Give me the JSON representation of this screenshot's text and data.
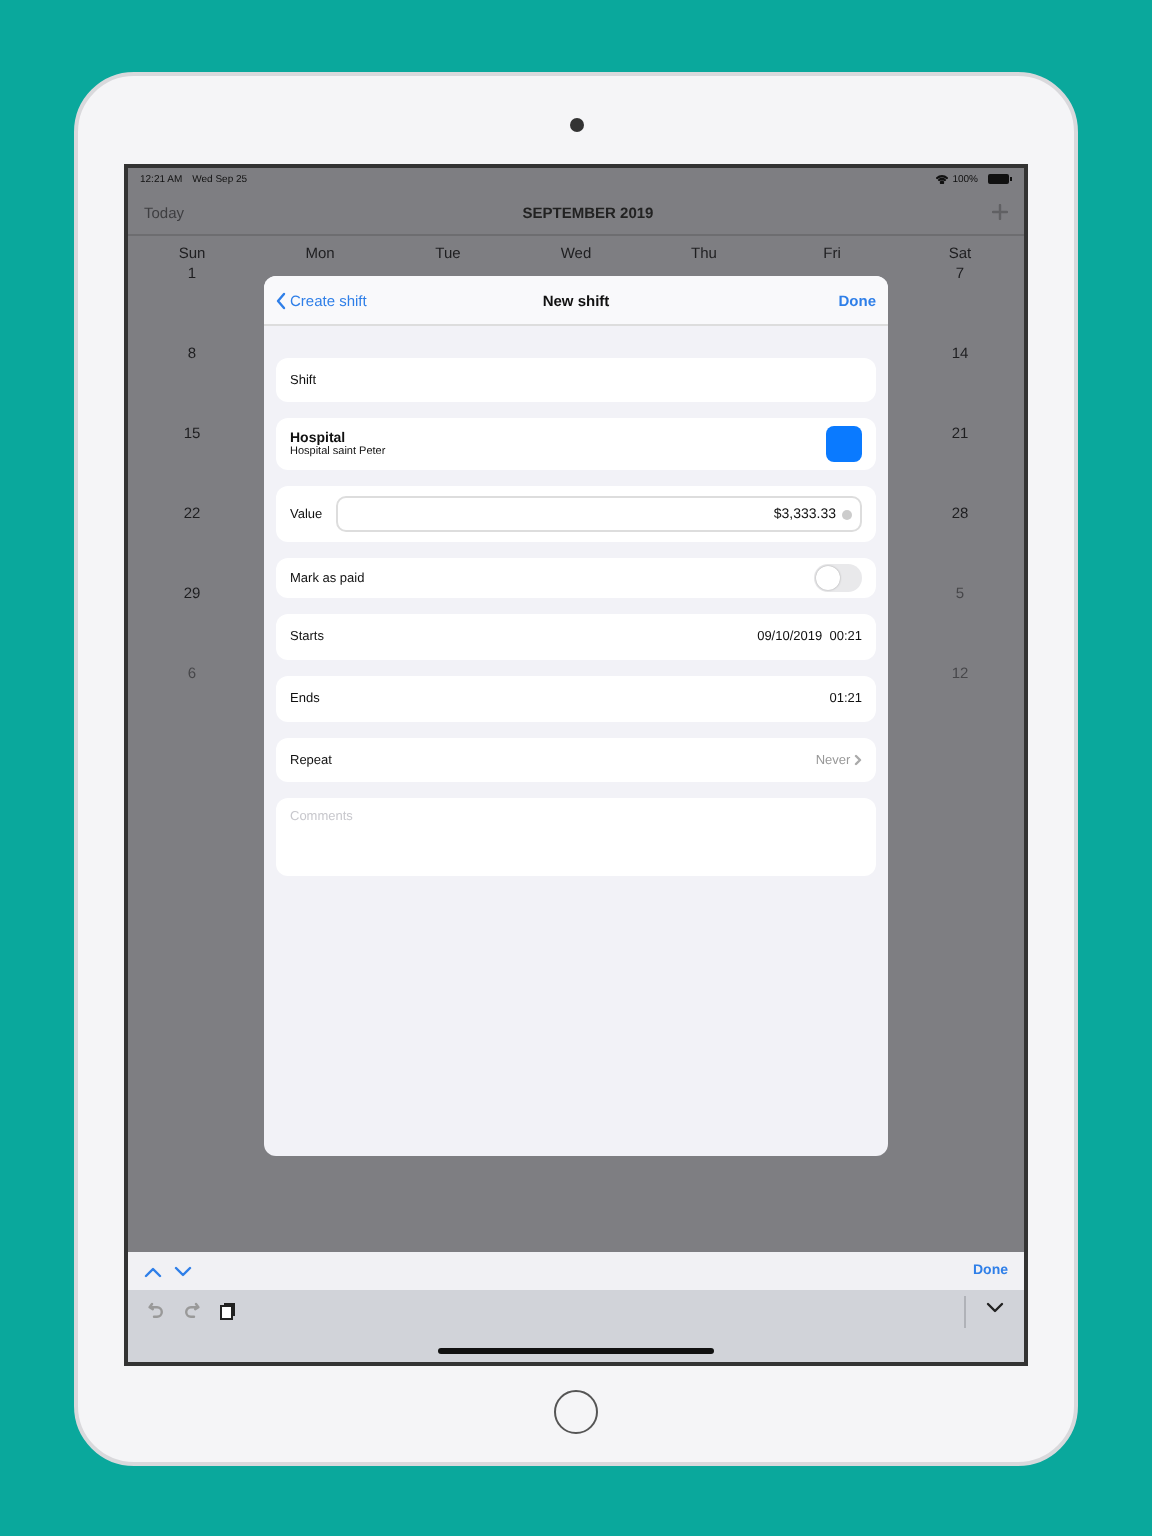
{
  "status_bar": {
    "time": "12:21 AM",
    "date": "Wed Sep 25",
    "battery": "100%"
  },
  "nav_bar": {
    "today": "Today",
    "title": "SEPTEMBER 2019"
  },
  "calendar": {
    "weekdays": [
      "Sun",
      "Mon",
      "Tue",
      "Wed",
      "Thu",
      "Fri",
      "Sat"
    ],
    "weeks": [
      {
        "sun": {
          "day": "1",
          "other_month": false
        },
        "sat": {
          "day": "7",
          "other_month": false
        }
      },
      {
        "sun": {
          "day": "8",
          "other_month": false
        },
        "sat": {
          "day": "14",
          "other_month": false
        }
      },
      {
        "sun": {
          "day": "15",
          "other_month": false
        },
        "sat": {
          "day": "21",
          "other_month": false
        }
      },
      {
        "sun": {
          "day": "22",
          "other_month": false
        },
        "sat": {
          "day": "28",
          "other_month": false
        }
      },
      {
        "sun": {
          "day": "29",
          "other_month": false
        },
        "sat": {
          "day": "5",
          "other_month": true
        }
      },
      {
        "sun": {
          "day": "6",
          "other_month": true
        },
        "sat": {
          "day": "12",
          "other_month": true
        }
      }
    ]
  },
  "sheet": {
    "back": "Create shift",
    "title": "New shift",
    "done": "Done",
    "rows": [
      {
        "kind": "label",
        "label": "Shift"
      },
      {
        "kind": "shift",
        "title": "Hospital",
        "subtitle": "Hospital saint Peter",
        "color": "#0a7aff"
      },
      {
        "kind": "value",
        "label": "Value",
        "value": "$3,333.33"
      },
      {
        "kind": "toggle",
        "label": "Mark as paid",
        "on": false
      },
      {
        "kind": "detail",
        "label": "Starts",
        "value": "09/10/2019  00:21"
      },
      {
        "kind": "detail",
        "label": "Ends",
        "value": "01:21"
      },
      {
        "kind": "disclosure",
        "label": "Repeat",
        "value": "Never"
      },
      {
        "kind": "comments",
        "placeholder": "Comments"
      }
    ]
  },
  "keyboard_bar": {
    "done": "Done"
  }
}
